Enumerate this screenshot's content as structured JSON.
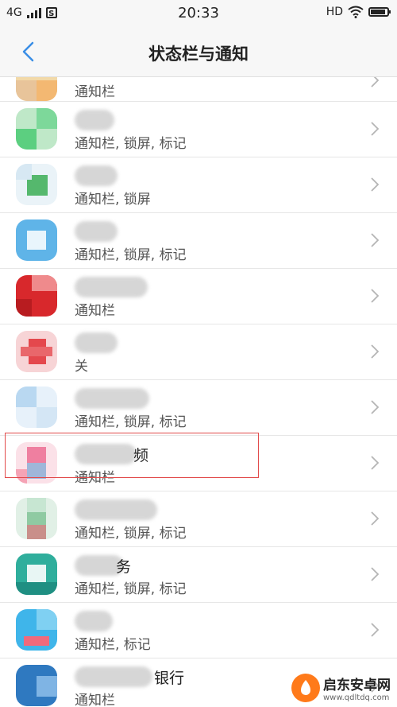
{
  "status_bar": {
    "network": "4G",
    "time": "20:33",
    "hd": "HD",
    "sim_letter": "S",
    "battery_level_pct": 90
  },
  "header": {
    "title": "状态栏与通知"
  },
  "apps": [
    {
      "name": "",
      "subtitle": "通知栏"
    },
    {
      "name": "",
      "subtitle": "通知栏, 锁屏, 标记"
    },
    {
      "name": "",
      "subtitle": "通知栏, 锁屏"
    },
    {
      "name": "",
      "subtitle": "通知栏, 锁屏, 标记"
    },
    {
      "name": "",
      "subtitle": "通知栏"
    },
    {
      "name": "",
      "subtitle": "关"
    },
    {
      "name": "",
      "subtitle": "通知栏, 锁屏, 标记"
    },
    {
      "name": "频",
      "subtitle": "通知栏"
    },
    {
      "name": "",
      "subtitle": "通知栏, 锁屏, 标记"
    },
    {
      "name": "务",
      "subtitle": "通知栏, 锁屏, 标记"
    },
    {
      "name": "",
      "subtitle": "通知栏, 标记"
    },
    {
      "name": "银行",
      "subtitle": "通知栏"
    }
  ],
  "watermark": {
    "text": "启东安卓网",
    "url": "www.qdltdq.com"
  },
  "colors": {
    "accent": "#3a8ee6",
    "highlight": "#e24b4b"
  }
}
